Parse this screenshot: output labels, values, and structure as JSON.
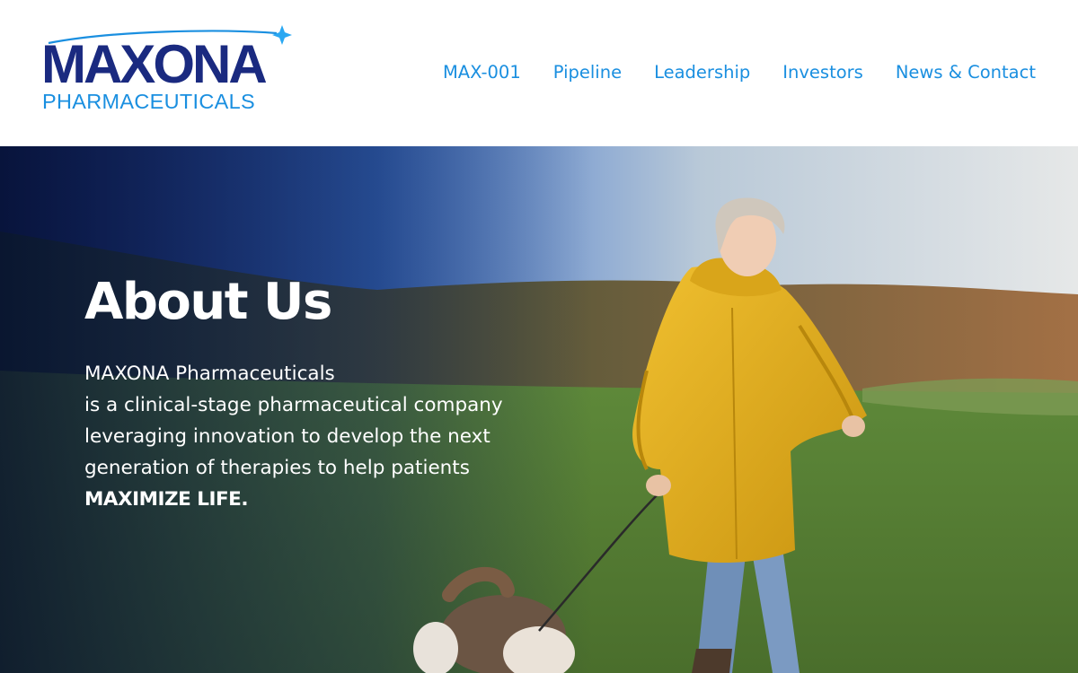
{
  "logo": {
    "main": "MAXONA",
    "sub": "PHARMACEUTICALS"
  },
  "nav": {
    "items": [
      {
        "label": "MAX-001"
      },
      {
        "label": "Pipeline"
      },
      {
        "label": "Leadership"
      },
      {
        "label": "Investors"
      },
      {
        "label": "News & Contact"
      }
    ]
  },
  "hero": {
    "title": "About Us",
    "lines": [
      "MAXONA Pharmaceuticals",
      "is a clinical-stage pharmaceutical company",
      "leveraging innovation to develop the next",
      "generation of therapies to help patients",
      "MAXIMIZE LIFE."
    ]
  },
  "colors": {
    "brand_navy": "#1a2a80",
    "brand_blue": "#1a8fe0",
    "jacket_yellow": "#e0ae18"
  }
}
